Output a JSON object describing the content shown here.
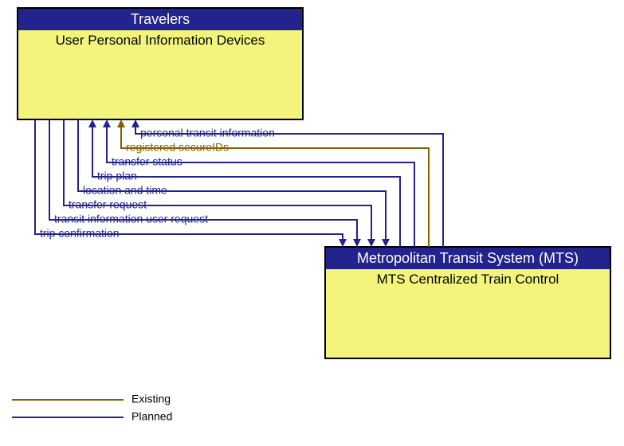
{
  "nodes": {
    "left": {
      "header": "Travelers",
      "body": "User Personal Information Devices"
    },
    "right": {
      "header": "Metropolitan Transit System (MTS)",
      "body": "MTS Centralized Train Control"
    }
  },
  "flows": [
    {
      "label": "personal transit information",
      "status": "planned",
      "direction": "to_left"
    },
    {
      "label": "registered secureIDs",
      "status": "existing",
      "direction": "to_left"
    },
    {
      "label": "transfer status",
      "status": "planned",
      "direction": "to_left"
    },
    {
      "label": "trip plan",
      "status": "planned",
      "direction": "to_left"
    },
    {
      "label": "location and time",
      "status": "planned",
      "direction": "to_right"
    },
    {
      "label": "transfer request",
      "status": "planned",
      "direction": "to_right"
    },
    {
      "label": "transit information user request",
      "status": "planned",
      "direction": "to_right"
    },
    {
      "label": "trip confirmation",
      "status": "planned",
      "direction": "to_right"
    }
  ],
  "legend": {
    "existing": "Existing",
    "planned": "Planned"
  },
  "colors": {
    "planned": "#23238e",
    "existing": "#806000",
    "node_header": "#23238e",
    "node_body": "#f2f47c"
  }
}
